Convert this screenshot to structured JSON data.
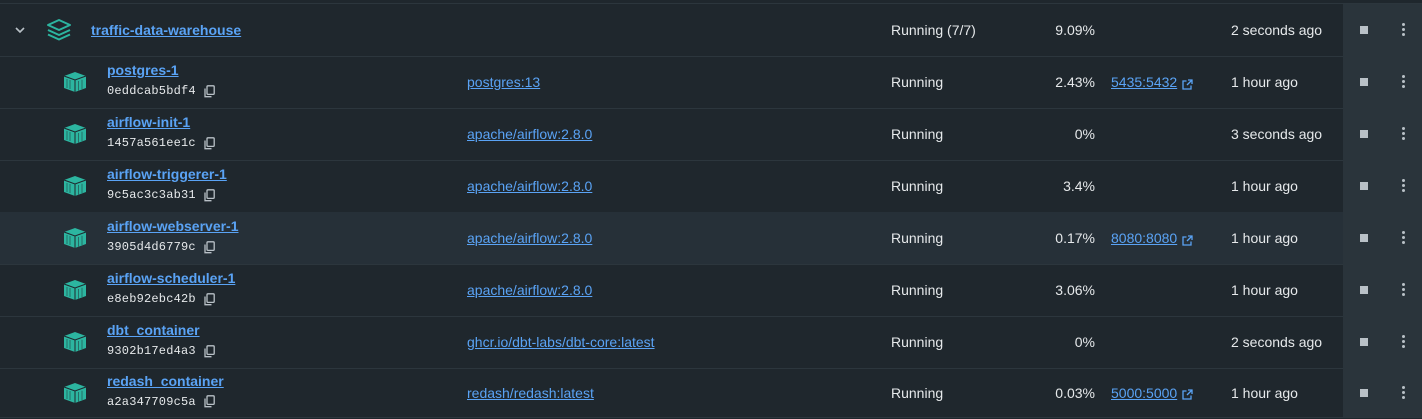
{
  "group": {
    "name": "traffic-data-warehouse",
    "status": "Running (7/7)",
    "cpu": "9.09%",
    "last_started": "2 seconds ago"
  },
  "containers": [
    {
      "name": "postgres-1",
      "id": "0eddcab5bdf4",
      "image": "postgres:13",
      "status": "Running",
      "cpu": "2.43%",
      "port": "5435:5432",
      "last_started": "1 hour ago"
    },
    {
      "name": "airflow-init-1",
      "id": "1457a561ee1c",
      "image": "apache/airflow:2.8.0",
      "status": "Running",
      "cpu": "0%",
      "port": "",
      "last_started": "3 seconds ago"
    },
    {
      "name": "airflow-triggerer-1",
      "id": "9c5ac3c3ab31",
      "image": "apache/airflow:2.8.0",
      "status": "Running",
      "cpu": "3.4%",
      "port": "",
      "last_started": "1 hour ago"
    },
    {
      "name": "airflow-webserver-1",
      "id": "3905d4d6779c",
      "image": "apache/airflow:2.8.0",
      "status": "Running",
      "cpu": "0.17%",
      "port": "8080:8080",
      "last_started": "1 hour ago"
    },
    {
      "name": "airflow-scheduler-1",
      "id": "e8eb92ebc42b",
      "image": "apache/airflow:2.8.0",
      "status": "Running",
      "cpu": "3.06%",
      "port": "",
      "last_started": "1 hour ago"
    },
    {
      "name": "dbt_container",
      "id": "9302b17ed4a3",
      "image": "ghcr.io/dbt-labs/dbt-core:latest",
      "status": "Running",
      "cpu": "0%",
      "port": "",
      "last_started": "2 seconds ago"
    },
    {
      "name": "redash_container",
      "id": "a2a347709c5a",
      "image": "redash/redash:latest",
      "status": "Running",
      "cpu": "0.03%",
      "port": "5000:5000",
      "last_started": "1 hour ago"
    }
  ],
  "icons": {
    "group_icon": "stack-layers-icon",
    "container_icon": "container-box-icon",
    "copy_icon": "copy-icon",
    "external_link_icon": "external-link-icon",
    "stop_icon": "stop-icon",
    "more_icon": "more-vertical-icon",
    "collapse_icon": "chevron-down-icon"
  },
  "colors": {
    "background": "#1f272d",
    "link": "#5aa3f5",
    "icon_teal": "#2cb5a0",
    "action_column": "#2a343b"
  }
}
